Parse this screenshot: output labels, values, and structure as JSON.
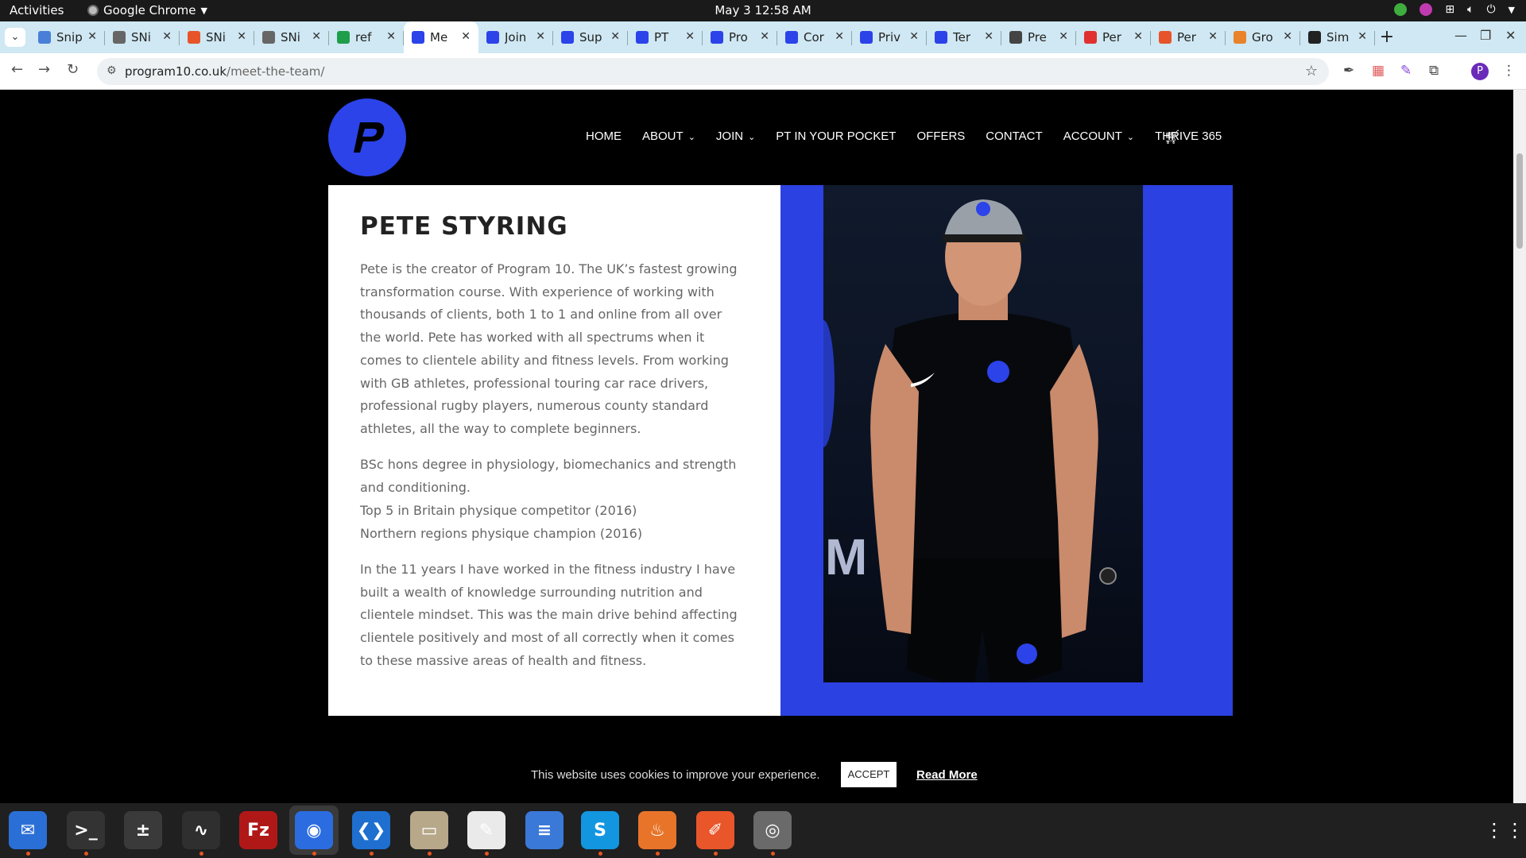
{
  "system": {
    "activities": "Activities",
    "app_name": "Google Chrome",
    "clock": "May 3  12:58 AM"
  },
  "tabs": [
    {
      "title": "Snip",
      "favicon_color": "#4a7fd8",
      "icon": "docs-icon"
    },
    {
      "title": "SNi",
      "favicon_color": "#666666",
      "icon": "snippet-icon"
    },
    {
      "title": "SNi",
      "favicon_color": "#e8542a",
      "icon": "chrome-icon"
    },
    {
      "title": "SNi",
      "favicon_color": "#666666",
      "icon": "snippet-icon"
    },
    {
      "title": "ref",
      "favicon_color": "#1e9e4a",
      "icon": "sheets-icon"
    },
    {
      "title": "Me",
      "favicon_color": "#2b43e8",
      "icon": "program10-icon",
      "active": true
    },
    {
      "title": "Join",
      "favicon_color": "#2b43e8",
      "icon": "program10-icon"
    },
    {
      "title": "Sup",
      "favicon_color": "#2b43e8",
      "icon": "program10-icon"
    },
    {
      "title": "PT",
      "favicon_color": "#2b43e8",
      "icon": "program10-icon"
    },
    {
      "title": "Pro",
      "favicon_color": "#2b43e8",
      "icon": "program10-icon"
    },
    {
      "title": "Cor",
      "favicon_color": "#2b43e8",
      "icon": "program10-icon"
    },
    {
      "title": "Priv",
      "favicon_color": "#2b43e8",
      "icon": "program10-icon"
    },
    {
      "title": "Ter",
      "favicon_color": "#2b43e8",
      "icon": "program10-icon"
    },
    {
      "title": "Pre",
      "favicon_color": "#444444",
      "icon": "page-icon"
    },
    {
      "title": "Per",
      "favicon_color": "#e03030",
      "icon": "red-icon"
    },
    {
      "title": "Per",
      "favicon_color": "#e8542a",
      "icon": "slides-icon"
    },
    {
      "title": "Gro",
      "favicon_color": "#e8832a",
      "icon": "group-icon"
    },
    {
      "title": "Sim",
      "favicon_color": "#222222",
      "icon": "sim-icon"
    }
  ],
  "address": {
    "domain": "program10.co.uk",
    "path": "/meet-the-team/"
  },
  "site": {
    "menu": [
      {
        "label": "HOME",
        "dropdown": false
      },
      {
        "label": "ABOUT",
        "dropdown": true
      },
      {
        "label": "JOIN",
        "dropdown": true
      },
      {
        "label": "PT IN YOUR POCKET",
        "dropdown": false
      },
      {
        "label": "OFFERS",
        "dropdown": false
      },
      {
        "label": "CONTACT",
        "dropdown": false
      },
      {
        "label": "ACCOUNT",
        "dropdown": true
      },
      {
        "label": "THRIVE 365",
        "dropdown": false
      }
    ],
    "brand_color": "#2b43e8"
  },
  "profile": {
    "name": "PETE STYRING",
    "para1": "Pete is the creator of Program 10. The UK’s fastest growing transformation course. With experience of working with thousands of clients, both 1 to 1 and online from all over the world. Pete has worked with all spectrums when it comes to clientele ability and fitness levels. From working with GB athletes, professional touring car race drivers, professional rugby players, numerous county standard athletes, all the way to complete beginners.",
    "qual1": "BSc hons degree in physiology, biomechanics and strength and conditioning.",
    "qual2": "Top 5 in Britain physique competitor (2016)",
    "qual3": "Northern regions physique champion (2016)",
    "para3": "In the 11 years I have worked in the fitness industry I have built a wealth of knowledge surrounding nutrition and clientele mindset. This was the main drive behind affecting clientele positively and most of all correctly when it comes to these massive areas of health and fitness."
  },
  "cookie": {
    "message": "This website uses cookies to improve your experience.",
    "accept": "ACCEPT",
    "read_more": "Read More"
  },
  "dock": [
    {
      "name": "thunderbird-icon",
      "color": "#2a6fd6",
      "glyph": "✉"
    },
    {
      "name": "terminal-icon",
      "color": "#333333",
      "glyph": ">_"
    },
    {
      "name": "calculator-icon",
      "color": "#3a3a3a",
      "glyph": "±"
    },
    {
      "name": "system-monitor-icon",
      "color": "#2f2f2f",
      "glyph": "∿"
    },
    {
      "name": "filezilla-icon",
      "color": "#b01818",
      "glyph": "Fz"
    },
    {
      "name": "chrome-icon",
      "color": "#2b6de0",
      "glyph": "◉"
    },
    {
      "name": "vscode-icon",
      "color": "#1e6fd0",
      "glyph": "❮❯"
    },
    {
      "name": "files-icon",
      "color": "#b7a88a",
      "glyph": "▭"
    },
    {
      "name": "text-editor-icon",
      "color": "#eaeaea",
      "glyph": "✎"
    },
    {
      "name": "writer-icon",
      "color": "#3a79d8",
      "glyph": "≡"
    },
    {
      "name": "skype-icon",
      "color": "#1296e0",
      "glyph": "S"
    },
    {
      "name": "blaze-icon",
      "color": "#e8742a",
      "glyph": "♨"
    },
    {
      "name": "inkscape-pen-icon",
      "color": "#e9562a",
      "glyph": "✐"
    },
    {
      "name": "disk-icon",
      "color": "#6a6a6a",
      "glyph": "◎"
    }
  ]
}
